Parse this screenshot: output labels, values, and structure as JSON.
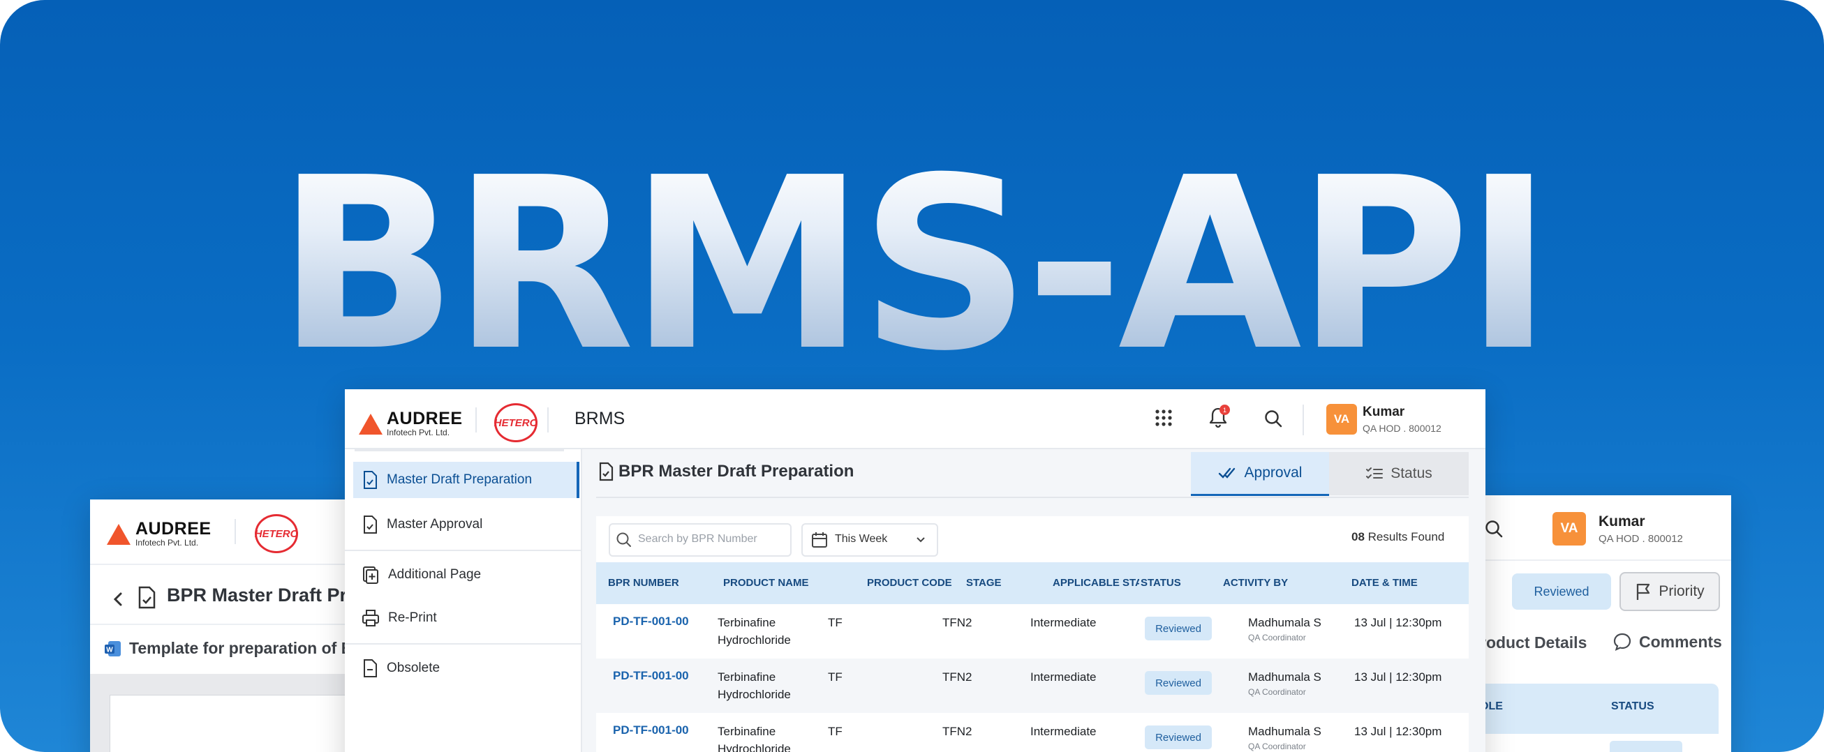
{
  "hero": {
    "title": "BRMS-API"
  },
  "brand": {
    "company": "AUDREE",
    "company_sub": "Infotech Pvt. Ltd.",
    "partner": "HETERO",
    "app": "BRMS"
  },
  "user": {
    "initials": "VA",
    "name": "Kumar",
    "role": "QA HOD . 800012"
  },
  "notifications": {
    "count": "1"
  },
  "sidebar": {
    "items": [
      {
        "label": "Master Draft Preparation"
      },
      {
        "label": "Master Approval"
      },
      {
        "label": "Additional Page"
      },
      {
        "label": "Re-Print"
      },
      {
        "label": "Obsolete"
      }
    ]
  },
  "main": {
    "title": "BPR Master Draft Preparation",
    "tabs": [
      {
        "label": "Approval"
      },
      {
        "label": "Status"
      }
    ],
    "search_placeholder": "Search by BPR Number",
    "date_filter": "This Week",
    "results_count": "08",
    "results_label": "Results Found"
  },
  "table": {
    "columns": [
      "BPR NUMBER",
      "PRODUCT NAME",
      "PRODUCT CODE",
      "STAGE",
      "APPLICABLE STAGE",
      "STATUS",
      "ACTIVITY BY",
      "DATE & TIME"
    ],
    "rows": [
      {
        "bpr": "PD-TF-001-00",
        "product_1": "Terbinafine",
        "product_2": "Hydrochloride",
        "code": "TF",
        "stage": "TFN2",
        "applicable": "Intermediate",
        "status": "Reviewed",
        "by": "Madhumala S",
        "by_role": "QA Coordinator",
        "date": "13 Jul | 12:30pm"
      },
      {
        "bpr": "PD-TF-001-00",
        "product_1": "Terbinafine",
        "product_2": "Hydrochloride",
        "code": "TF",
        "stage": "TFN2",
        "applicable": "Intermediate",
        "status": "Reviewed",
        "by": "Madhumala S",
        "by_role": "QA Coordinator",
        "date": "13 Jul | 12:30pm"
      },
      {
        "bpr": "PD-TF-001-00",
        "product_1": "Terbinafine",
        "product_2": "Hydrochloride",
        "code": "TF",
        "stage": "TFN2",
        "applicable": "Intermediate",
        "status": "Reviewed",
        "by": "Madhumala S",
        "by_role": "QA Coordinator",
        "date": "13 Jul | 12:30pm"
      }
    ]
  },
  "left_panel": {
    "title": "BPR Master Draft Pre",
    "template_label": "Template for preparation of BI"
  },
  "right_panel": {
    "status_badge": "Reviewed",
    "priority_label": "Priority",
    "tab_details": "roduct Details",
    "tab_comments": "Comments",
    "col_role": "OLE",
    "col_status": "STATUS"
  },
  "colors": {
    "accent": "#1466b8",
    "avatar": "#f7913a",
    "brand_red": "#e52b32",
    "badge_bg": "#d5e8f8"
  }
}
